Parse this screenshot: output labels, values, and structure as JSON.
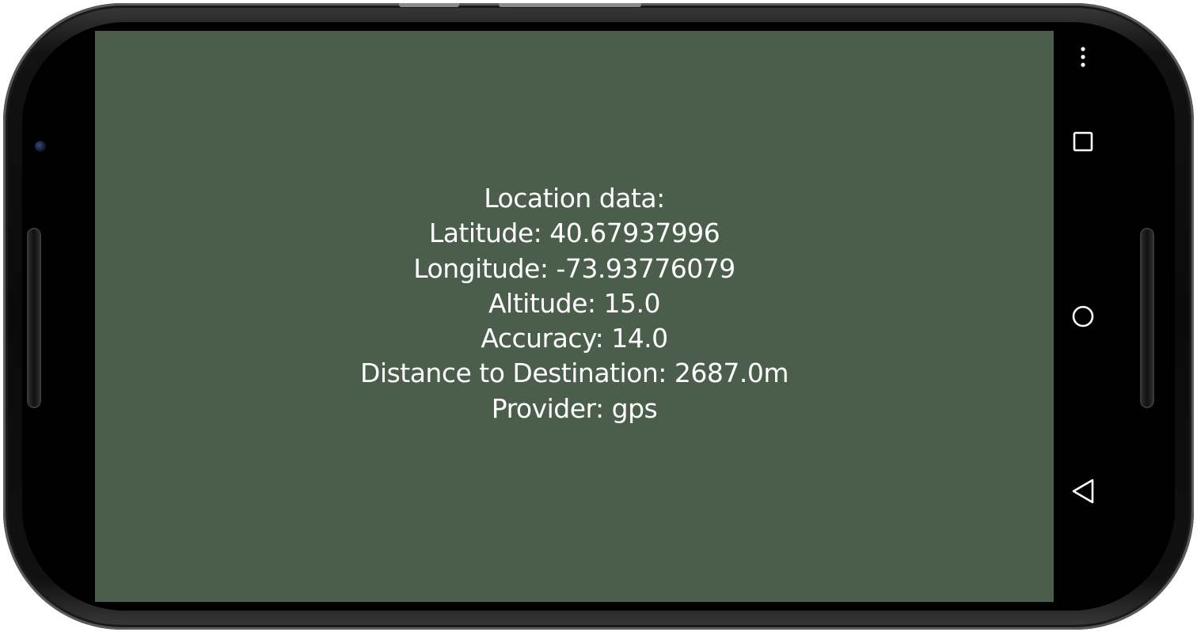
{
  "location": {
    "heading": "Location data:",
    "latitude": "Latitude: 40.67937996",
    "longitude": "Longitude: -73.93776079",
    "altitude": "Altitude: 15.0",
    "accuracy": "Accuracy: 14.0",
    "distance": "Distance to Destination: 2687.0m",
    "provider": "Provider: gps"
  },
  "navigation": {
    "buttons": [
      "overflow-menu-icon",
      "recents-icon",
      "home-icon",
      "back-icon"
    ]
  },
  "colors": {
    "screen_background": "#4a5e4b",
    "text": "#ffffff",
    "navbar": "#000000"
  }
}
